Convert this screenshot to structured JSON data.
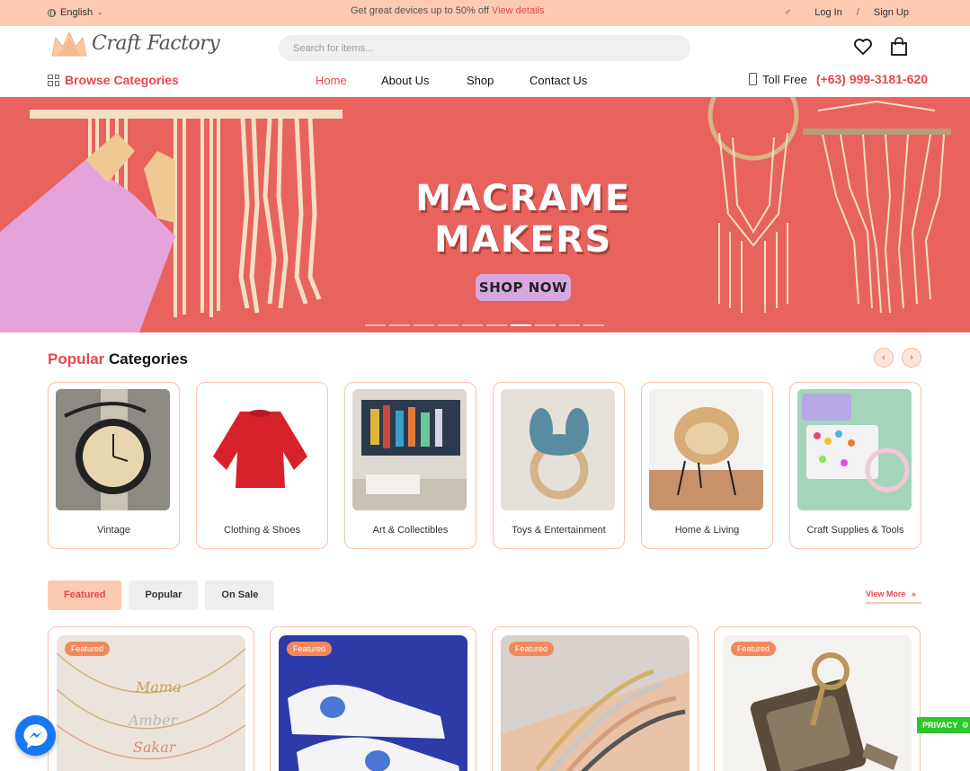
{
  "topbar": {
    "language": "English",
    "promo_text": "Get great devices up to 50% off",
    "promo_link": "View details",
    "login": "Log In",
    "separator": "/",
    "signup": "Sign Up"
  },
  "header": {
    "brand": "Craft Factory",
    "search_placeholder": "Search for items..."
  },
  "nav": {
    "browse": "Browse Categories",
    "items": [
      "Home",
      "About Us",
      "Shop",
      "Contact Us"
    ],
    "active": "Home",
    "toll_label": "Toll Free",
    "toll_number": "(+63) 999-3181-620"
  },
  "banner": {
    "title_line1": "MACRAME",
    "title_line2": "MAKERS",
    "cta": "SHOP NOW",
    "slide_count": 10,
    "active_slide": 7
  },
  "popular": {
    "title_accent": "Popular",
    "title_rest": "Categories",
    "categories": [
      {
        "label": "Vintage"
      },
      {
        "label": "Clothing & Shoes"
      },
      {
        "label": "Art & Collectibles"
      },
      {
        "label": "Toys & Entertainment"
      },
      {
        "label": "Home & Living"
      },
      {
        "label": "Craft Supplies & Tools"
      }
    ]
  },
  "tabs": {
    "items": [
      "Featured",
      "Popular",
      "On Sale"
    ],
    "active": "Featured",
    "view_more": "View More"
  },
  "products": [
    {
      "badge": "Featured"
    },
    {
      "badge": "Featured"
    },
    {
      "badge": "Featured"
    },
    {
      "badge": "Featured"
    }
  ],
  "widgets": {
    "privacy": "PRIVACY"
  },
  "colors": {
    "accent": "#e8474e",
    "topbar": "#fcc9b1",
    "banner": "#e8635e",
    "cta": "#d7a7e0"
  }
}
